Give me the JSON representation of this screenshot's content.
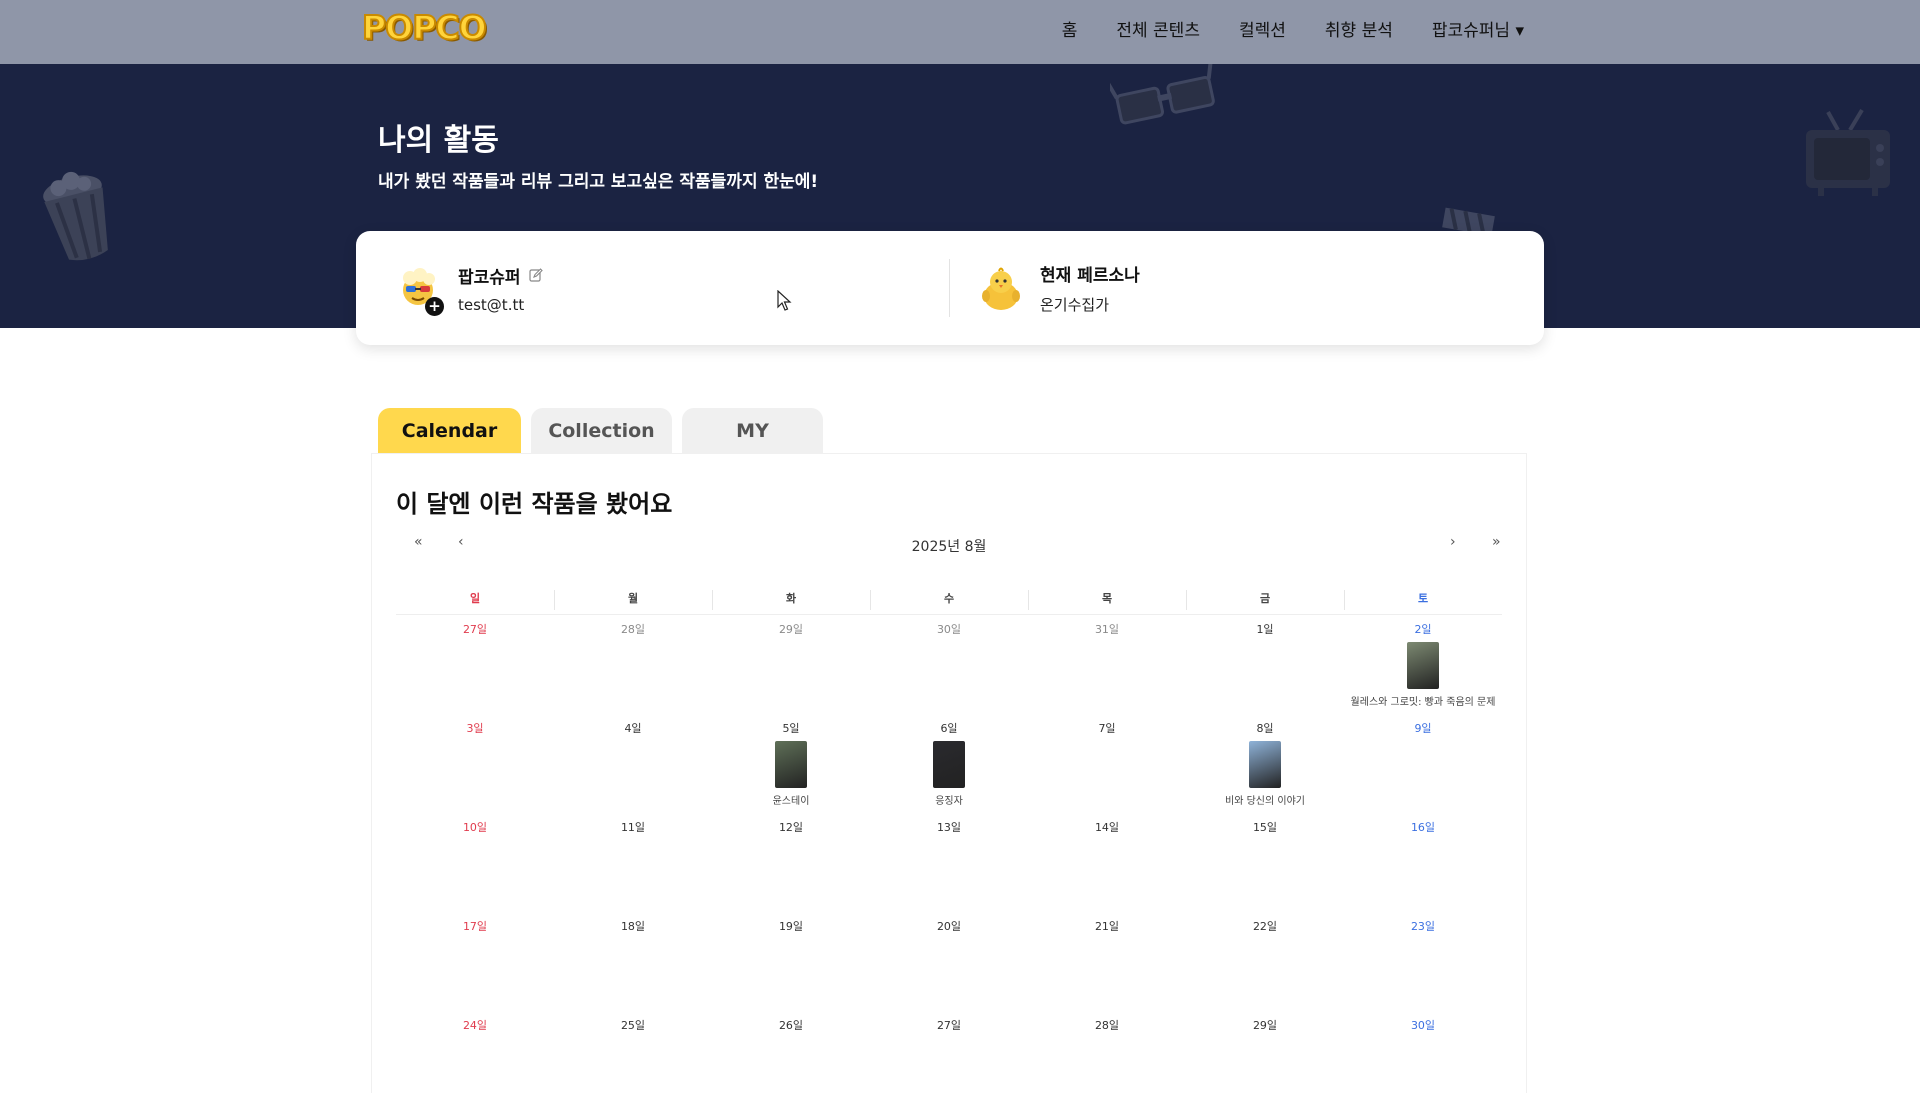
{
  "brand": {
    "logo_text": "POPCO"
  },
  "nav": {
    "items": [
      "홈",
      "전체 콘텐츠",
      "컬렉션",
      "취향 분석"
    ],
    "user_menu": "팝코슈퍼님 ▾"
  },
  "hero": {
    "title": "나의 활동",
    "subtitle": "내가 봤던 작품들과 리뷰 그리고 보고싶은 작품들까지 한눈에!"
  },
  "profile": {
    "name": "팝코슈퍼",
    "email": "test@t.tt",
    "persona_label": "현재 페르소나",
    "persona_value": "온기수집가"
  },
  "tabs": [
    "Calendar",
    "Collection",
    "MY"
  ],
  "calendar": {
    "title": "이 달엔 이런 작품을 봤어요",
    "month_label": "2025년 8월",
    "nav": {
      "first": "«",
      "prev": "‹",
      "next": "›",
      "last": "»"
    },
    "weekdays": [
      "일",
      "월",
      "화",
      "수",
      "목",
      "금",
      "토"
    ],
    "weeks": [
      [
        {
          "label": "27일",
          "muted": true
        },
        {
          "label": "28일",
          "muted": true
        },
        {
          "label": "29일",
          "muted": true
        },
        {
          "label": "30일",
          "muted": true
        },
        {
          "label": "31일",
          "muted": true
        },
        {
          "label": "1일"
        },
        {
          "label": "2일",
          "poster_color": "#7d8a72",
          "title": "월레스와 그로밋: 빵과 죽음의 문제"
        }
      ],
      [
        {
          "label": "3일"
        },
        {
          "label": "4일"
        },
        {
          "label": "5일",
          "poster_color": "#5f7058",
          "title": "윤스테이"
        },
        {
          "label": "6일",
          "poster_color": "#2a2a2e",
          "title": "응징자"
        },
        {
          "label": "7일"
        },
        {
          "label": "8일",
          "poster_color": "#8fb3d9",
          "title": "비와 당신의 이야기"
        },
        {
          "label": "9일"
        }
      ],
      [
        {
          "label": "10일"
        },
        {
          "label": "11일"
        },
        {
          "label": "12일"
        },
        {
          "label": "13일"
        },
        {
          "label": "14일"
        },
        {
          "label": "15일"
        },
        {
          "label": "16일"
        }
      ],
      [
        {
          "label": "17일"
        },
        {
          "label": "18일"
        },
        {
          "label": "19일"
        },
        {
          "label": "20일"
        },
        {
          "label": "21일"
        },
        {
          "label": "22일"
        },
        {
          "label": "23일"
        }
      ],
      [
        {
          "label": "24일"
        },
        {
          "label": "25일"
        },
        {
          "label": "26일"
        },
        {
          "label": "27일"
        },
        {
          "label": "28일"
        },
        {
          "label": "29일"
        },
        {
          "label": "30일"
        }
      ]
    ]
  },
  "colors": {
    "topbar": "#8f96a8",
    "hero": "#1b2342",
    "accent_tab": "#ffd84d",
    "sunday": "#e03b4d",
    "saturday": "#3b6fe0"
  }
}
